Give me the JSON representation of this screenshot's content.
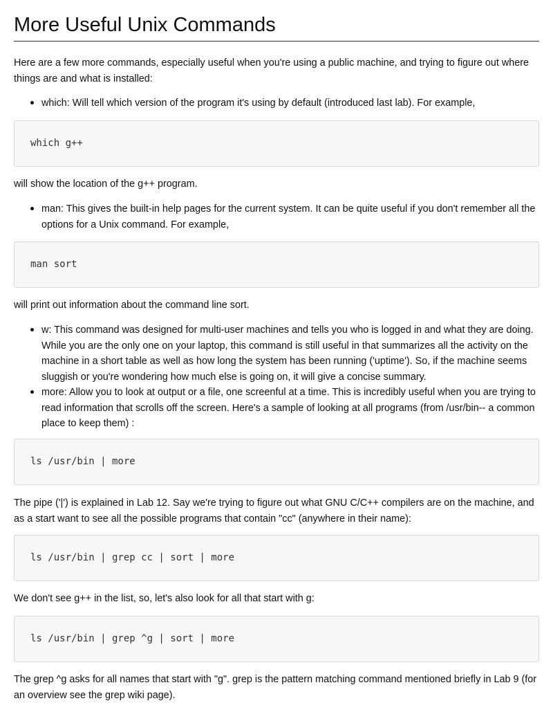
{
  "page_title": "More Useful Unix Commands",
  "intro": "Here are a few more commands, especially useful when you're using a public machine, and trying to figure out where things are and what is installed:",
  "which": {
    "bullet": "which: Will tell which version of the program it's using by default (introduced last lab). For example,",
    "code": "which g++",
    "after": "will show the location of the g++ program."
  },
  "man": {
    "bullet": "man: This gives the built-in help pages for the current system. It can be quite useful if you don't remember all the options for a Unix command. For example,",
    "code": "man sort",
    "after": "will print out information about the command line sort."
  },
  "w": {
    "bullet": "w: This command was designed for multi-user machines and tells you who is logged in and what they are doing. While you are the only one on your laptop, this command is still useful in that summarizes all the activity on the machine in a short table as well as how long the system has been running ('uptime'). So, if the machine seems sluggish or you're wondering how much else is going on, it will give a concise summary."
  },
  "more": {
    "bullet": "more: Allow you to look at output or a file, one screenful at a time. This is incredibly useful when you are trying to read information that scrolls off the screen. Here's a sample of looking at all programs (from /usr/bin-- a common place to keep them) :",
    "code": "ls /usr/bin | more"
  },
  "pipe": {
    "text": "The pipe ('|') is explained in Lab 12. Say we're trying to figure out what GNU C/C++ compilers are on the machine, and as a start want to see all the possible programs that contain \"cc\" (anywhere in their name):",
    "code": "ls /usr/bin | grep cc | sort | more"
  },
  "gpp": {
    "text": "We don't see g++ in the list, so, let's also look for all that start with g:",
    "code": "ls /usr/bin | grep ^g | sort | more"
  },
  "grep_note": "The grep ^g asks for all names that start with \"g\". grep is the pattern matching command mentioned briefly in Lab 9 (for an overview see the grep wiki page)."
}
